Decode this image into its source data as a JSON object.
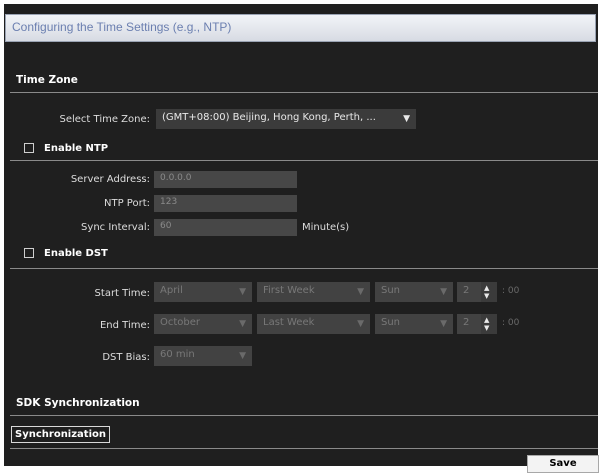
{
  "window": {
    "title": "Configuring the Time Settings (e.g., NTP)"
  },
  "time_zone": {
    "section_title": "Time Zone",
    "select_label": "Select Time Zone:",
    "selected_value": "(GMT+08:00) Beijing, Hong Kong, Perth, ..."
  },
  "ntp": {
    "checkbox_label": "Enable NTP",
    "server_label": "Server Address:",
    "server_value": "0.0.0.0",
    "port_label": "NTP Port:",
    "port_value": "123",
    "interval_label": "Sync Interval:",
    "interval_value": "60",
    "interval_unit": "Minute(s)"
  },
  "dst": {
    "checkbox_label": "Enable DST",
    "start_label": "Start Time:",
    "start_month": "April",
    "start_week": "First Week",
    "start_day": "Sun",
    "start_hour": "2",
    "start_minutes": ": 00",
    "end_label": "End Time:",
    "end_month": "October",
    "end_week": "Last Week",
    "end_day": "Sun",
    "end_hour": "2",
    "end_minutes": ": 00",
    "bias_label": "DST Bias:",
    "bias_value": "60 min"
  },
  "sdk": {
    "section_title": "SDK Synchronization",
    "sync_button": "Synchronization"
  },
  "footer": {
    "save_label": "Save"
  },
  "colors": {
    "panel_bg": "#1f1f1f",
    "field_bg": "#3b3b3b",
    "title_text": "#6b7fb0"
  }
}
